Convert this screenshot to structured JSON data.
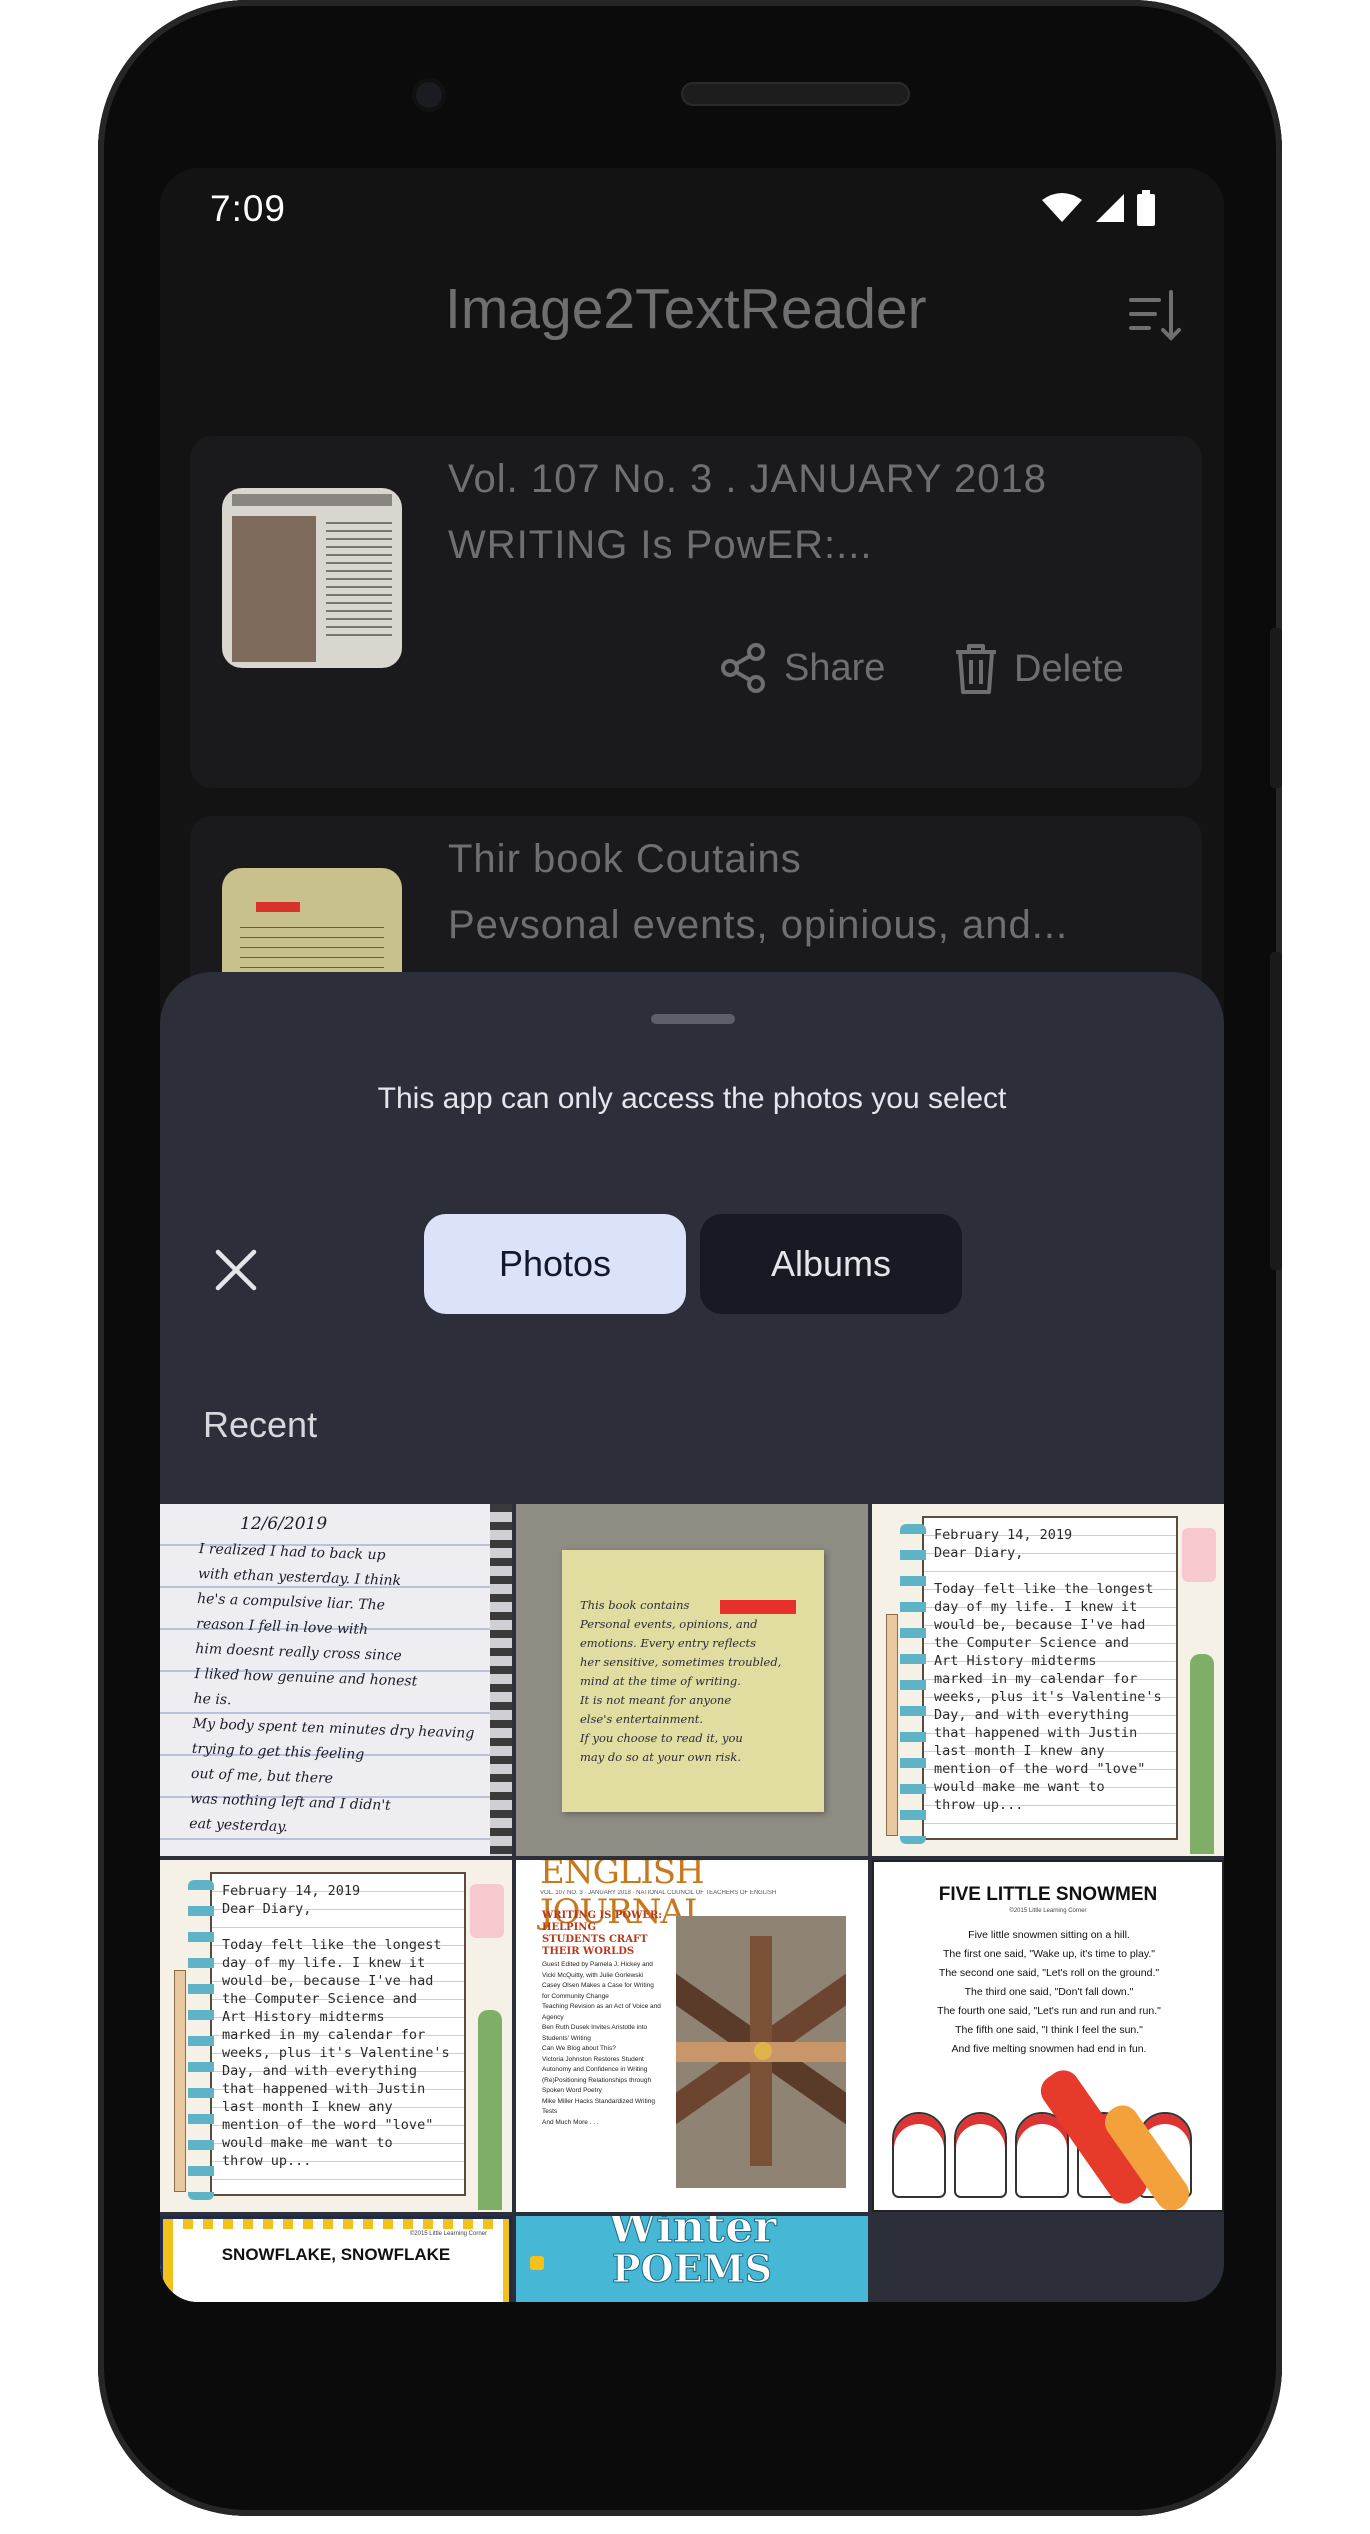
{
  "status": {
    "time": "7:09"
  },
  "app": {
    "title": "Image2TextReader"
  },
  "cards": [
    {
      "line1": "Vol. 107 No. 3 . JANUARY 2018",
      "line2": "WRITING Is PowER:...",
      "share_label": "Share",
      "delete_label": "Delete"
    },
    {
      "line1": "Thir book Coutains",
      "line2": "Pevsonal events, opinious, and..."
    }
  ],
  "sheet": {
    "message": "This app can only access the photos you select",
    "tab_photos": "Photos",
    "tab_albums": "Albums",
    "section_label": "Recent"
  },
  "photos": {
    "diary_date": "12/6/2019",
    "diary_text": "I realized I had to back up\nwith ethan yesterday. I think\nhe's a compulsive liar. The\nreason I fell in love with\nhim doesnt really cross since\nI liked how genuine and honest\nhe is.\nMy body spent ten minutes dry heaving\ntrying to get this feeling\nout of me, but there\nwas nothing left and I didn't\neat yesterday.",
    "note_text": "This book contains\nPersonal events, opinions, and\nemotions. Every entry reflects\nher sensitive, sometimes troubled,\nmind at the time of writing.\nIt is not meant for anyone\nelse's entertainment.\nIf you choose to read it, you\nmay do so at your own risk.",
    "journal_text": "February 14, 2019\nDear Diary,\n\nToday felt like the longest\nday of my life. I knew it\nwould be, because I've had\nthe Computer Science and\nArt History midterms\nmarked in my calendar for\nweeks, plus it's Valentine's\nDay, and with everything\nthat happened with Justin\nlast month I knew any\nmention of the word \"love\"\nwould make me want to\nthrow up...",
    "ej_title": "ENGLISH JOURNAL",
    "ej_header": "VOL. 107 NO. 3 · JANUARY 2018 · NATIONAL COUNCIL OF TEACHERS OF ENGLISH",
    "ej_feature": "WRITING IS POWER: HELPING STUDENTS CRAFT THEIR WORLDS",
    "ej_list": "Guest Edited by Pamela J. Hickey and Vicki McQuitty, with Julie Gorlewski\nCasey Olsen Makes a Case for Writing for Community Change\nTeaching Revision as an Act of Voice and Agency\nBen Ruth Dusek Invites Aristotle into Students' Writing\nCan We Blog about This?\nVictoria Johnston Restores Student Autonomy and Confidence in Writing\n(Re)Positioning Relationships through Spoken Word Poetry\nMike Miller Hacks Standardized Writing Tests\nAnd Much More . . .",
    "snowmen_title": "FIVE LITTLE SNOWMEN",
    "snowmen_text": "Five little snowmen sitting on a hill.\nThe first one said, \"Wake up, it's time to play.\"\nThe second one said, \"Let's roll on the ground.\"\nThe third one said, \"Don't fall down.\"\nThe fourth one said, \"Let's run and run and run.\"\nThe fifth one said, \"I think I feel the sun.\"\nAnd five melting snowmen had end in fun.",
    "snowmen_credit": "©2015 Little Learning Corner",
    "snowflake_title": "SNOWFLAKE, SNOWFLAKE",
    "snowflake_credit": "©2015 Little Learning Corner",
    "winter_title": "Winter",
    "winter_sub": "POEMS"
  }
}
